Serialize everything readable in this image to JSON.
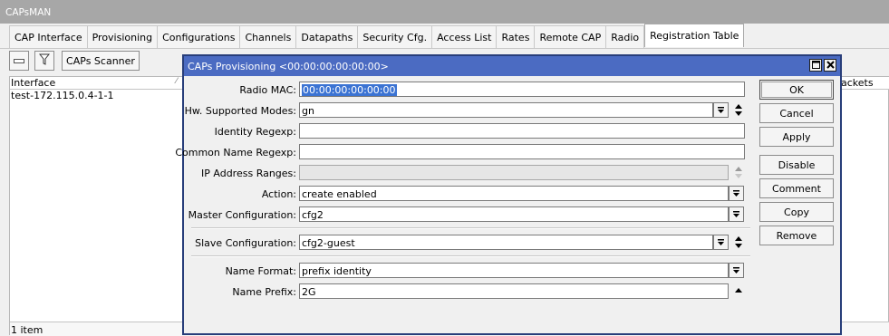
{
  "window": {
    "title": "CAPsMAN"
  },
  "tabs": [
    {
      "label": "CAP Interface"
    },
    {
      "label": "Provisioning"
    },
    {
      "label": "Configurations"
    },
    {
      "label": "Channels"
    },
    {
      "label": "Datapaths"
    },
    {
      "label": "Security Cfg."
    },
    {
      "label": "Access List"
    },
    {
      "label": "Rates"
    },
    {
      "label": "Remote CAP"
    },
    {
      "label": "Radio"
    },
    {
      "label": "Registration Table"
    }
  ],
  "toolbar": {
    "scanner_label": "CAPs Scanner"
  },
  "table": {
    "column_interface": "Interface",
    "column_packets_partial": "ackets",
    "rows": [
      {
        "interface": "test-172.115.0.4-1-1"
      }
    ],
    "status": "1 item"
  },
  "dialog": {
    "title": "CAPs Provisioning <00:00:00:00:00:00>",
    "fields": {
      "radio_mac": {
        "label": "Radio MAC:",
        "value": "00:00:00:00:00:00"
      },
      "hw_modes": {
        "label": "Hw. Supported Modes:",
        "value": "gn"
      },
      "identity_regexp": {
        "label": "Identity Regexp:",
        "value": ""
      },
      "common_name_regexp": {
        "label": "Common Name Regexp:",
        "value": ""
      },
      "ip_ranges": {
        "label": "IP Address Ranges:",
        "value": ""
      },
      "action": {
        "label": "Action:",
        "value": "create enabled"
      },
      "master_config": {
        "label": "Master Configuration:",
        "value": "cfg2"
      },
      "slave_config": {
        "label": "Slave Configuration:",
        "value": "cfg2-guest"
      },
      "name_format": {
        "label": "Name Format:",
        "value": "prefix identity"
      },
      "name_prefix": {
        "label": "Name Prefix:",
        "value": "2G"
      }
    },
    "buttons": {
      "ok": "OK",
      "cancel": "Cancel",
      "apply": "Apply",
      "disable": "Disable",
      "comment": "Comment",
      "copy": "Copy",
      "remove": "Remove"
    }
  },
  "colors": {
    "dialog_title_bg": "#4b6bc2",
    "selection": "#3b73d3",
    "main_title_bg": "#a7a7a7"
  },
  "icons": [
    "minus-icon",
    "filter-icon",
    "restore-icon",
    "close-icon",
    "dropdown-icon",
    "up-down-icon",
    "up-icon"
  ]
}
